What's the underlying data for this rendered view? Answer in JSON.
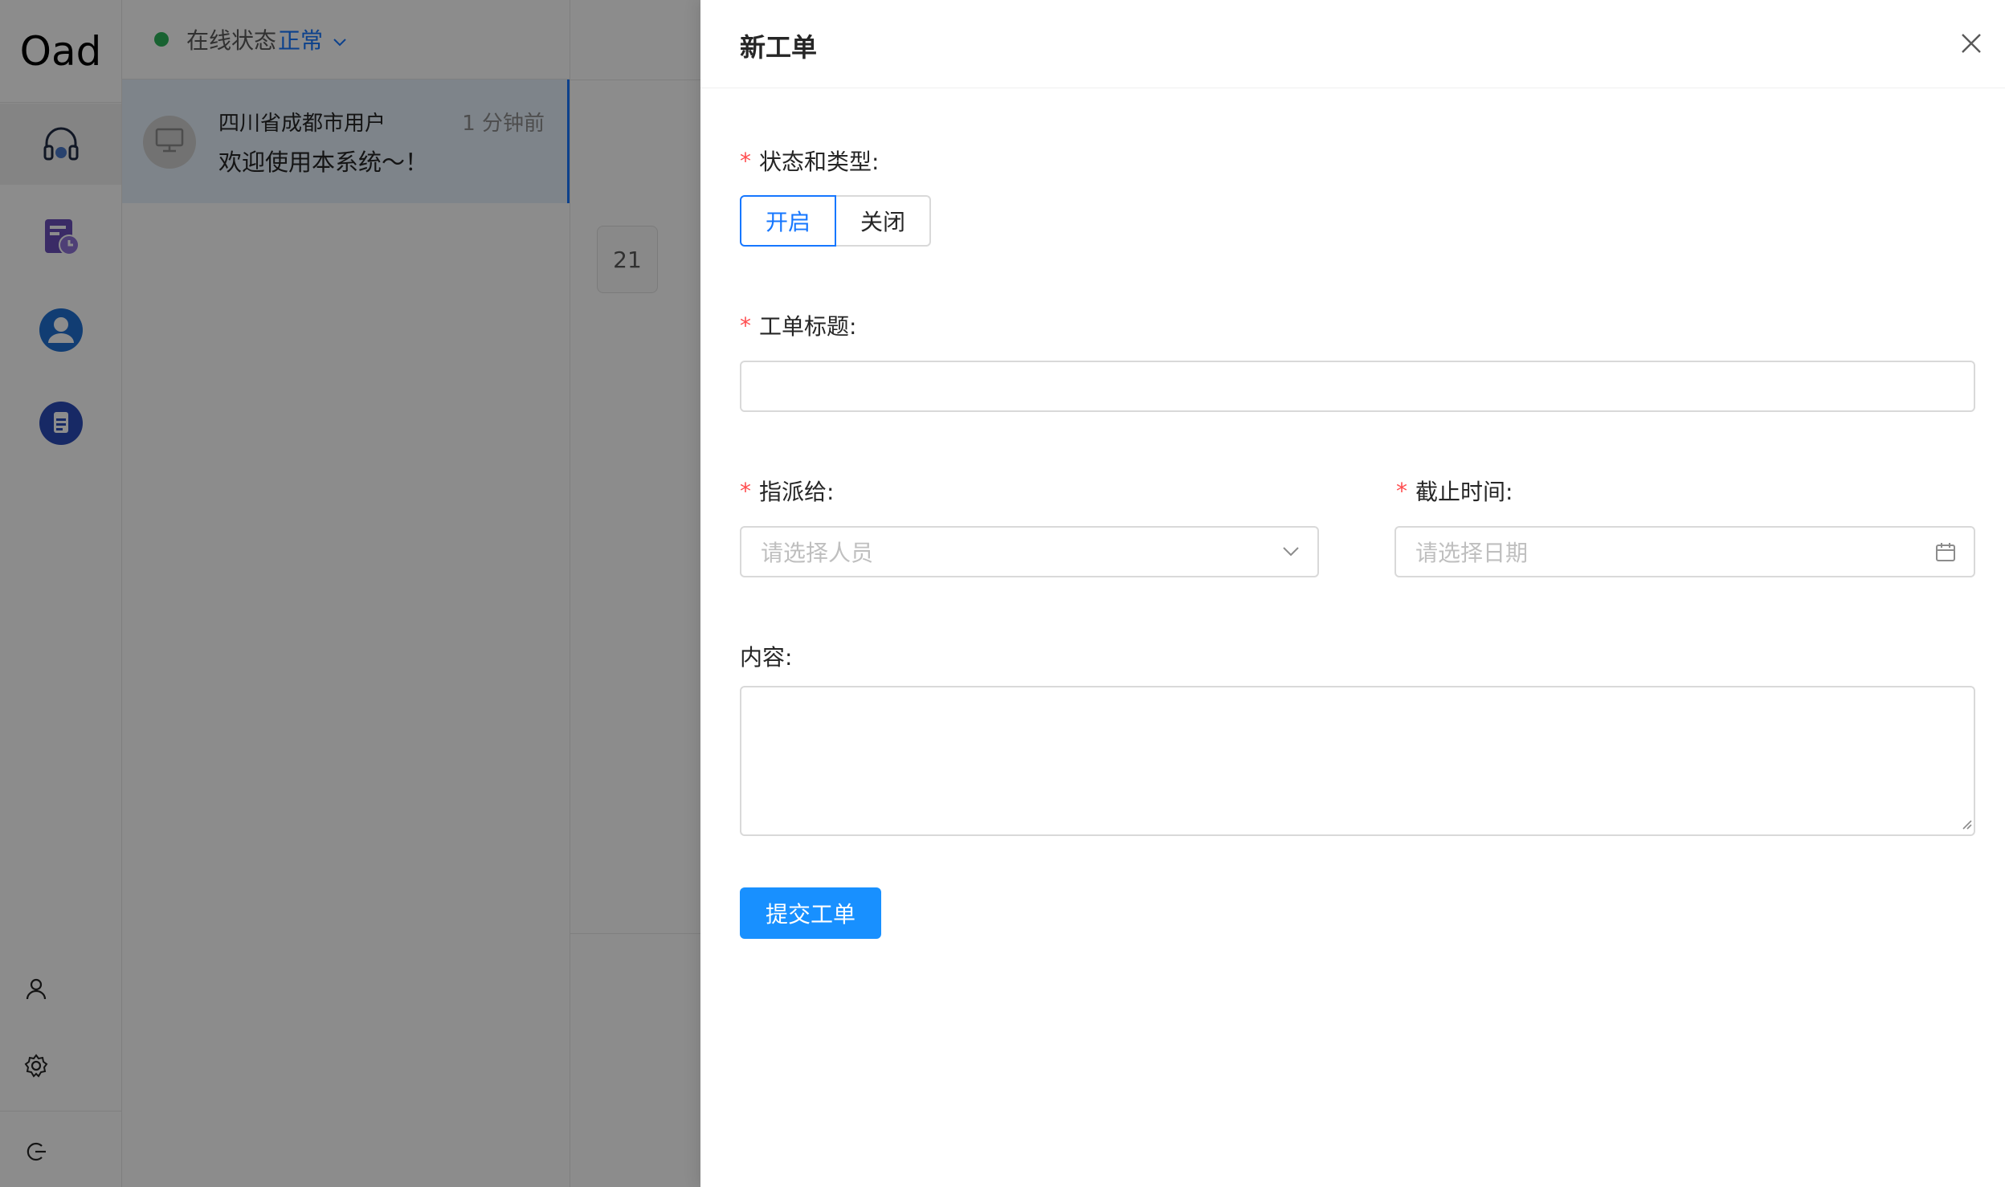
{
  "app": {
    "logo": "Oad",
    "rail": {
      "items": [
        {
          "icon": "headset-icon",
          "active": true
        },
        {
          "icon": "ticket-clock-icon",
          "active": false
        },
        {
          "icon": "user-circle-icon",
          "active": false
        },
        {
          "icon": "document-icon",
          "active": false
        }
      ],
      "bottom": [
        {
          "icon": "profile-icon"
        },
        {
          "icon": "settings-icon"
        },
        {
          "icon": "logout-icon"
        }
      ]
    },
    "status": {
      "label": "在线状态",
      "value": "正常",
      "caret": "∨",
      "dot_color": "#2db35a"
    },
    "conversations": [
      {
        "name": "四川省成都市用户",
        "time": "1 分钟前",
        "message": "欢迎使用本系统～！"
      }
    ],
    "chat": {
      "date_badge": "21"
    }
  },
  "drawer": {
    "title": "新工单",
    "fields": {
      "status_type": {
        "label": "状态和类型:",
        "options": [
          "开启",
          "关闭"
        ],
        "selected": "开启"
      },
      "title": {
        "label": "工单标题:",
        "value": ""
      },
      "assignee": {
        "label": "指派给:",
        "placeholder": "请选择人员"
      },
      "deadline": {
        "label": "截止时间:",
        "placeholder": "请选择日期"
      },
      "content": {
        "label": "内容:",
        "value": ""
      }
    },
    "submit_label": "提交工单"
  },
  "colors": {
    "primary": "#1890ff",
    "required": "#ff4d4f",
    "status_online": "#2db35a",
    "rail_icon_purple": "#6b4fbb",
    "rail_icon_blue": "#1f6fd1",
    "rail_icon_navy": "#2b4bb8"
  }
}
